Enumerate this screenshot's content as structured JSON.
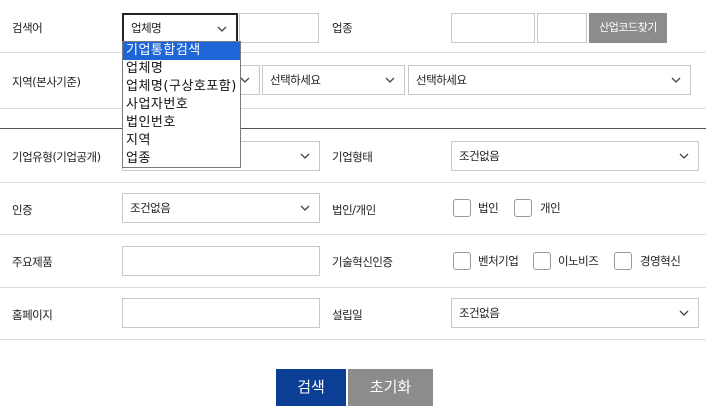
{
  "search": {
    "label": "검색어",
    "selected": "업체명",
    "options": [
      "기업통합검색",
      "업체명",
      "업체명(구상호포함)",
      "사업자번호",
      "법인번호",
      "지역",
      "업종"
    ],
    "highlighted_option": "기업통합검색",
    "text": ""
  },
  "industry": {
    "label": "업종",
    "code1": "",
    "code2": "",
    "find_button": "산업코드찾기"
  },
  "region": {
    "label": "지역(본사기준)",
    "select2": "선택하세요",
    "select3": "선택하세요"
  },
  "company_type_public": {
    "label": "기업유형(기업공개)"
  },
  "company_form": {
    "label": "기업형태",
    "value": "조건없음"
  },
  "certification": {
    "label": "인증",
    "value": "조건없음"
  },
  "entity": {
    "label": "법인/개인",
    "options": [
      "법인",
      "개인"
    ]
  },
  "main_products": {
    "label": "주요제품",
    "value": ""
  },
  "tech_innovation": {
    "label": "기술혁신인증",
    "options": [
      "벤처기업",
      "이노비즈",
      "경영혁신"
    ]
  },
  "homepage": {
    "label": "홈페이지",
    "value": ""
  },
  "founding_date": {
    "label": "설립일",
    "value": "조건없음"
  },
  "actions": {
    "search": "검색",
    "reset": "초기화"
  },
  "colors": {
    "primary_button": "#0b3f96",
    "secondary_button": "#8c8c8c",
    "highlight": "#1e66d8"
  }
}
